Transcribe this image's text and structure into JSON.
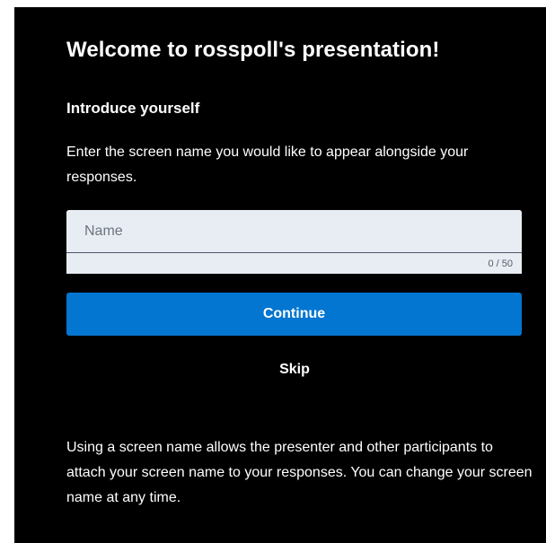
{
  "panel": {
    "title": "Welcome to rosspoll's presentation!",
    "subtitle": "Introduce yourself",
    "instructions": "Enter the screen name you would like to appear alongside your responses.",
    "name_input": {
      "value": "",
      "placeholder": "Name",
      "counter": "0 / 50"
    },
    "continue_label": "Continue",
    "skip_label": "Skip",
    "note": "Using a screen name allows the presenter and other participants to attach your screen name to your responses. You can change your screen name at any time."
  },
  "colors": {
    "panel_background": "#000000",
    "text": "#ffffff",
    "accent": "#0276d1",
    "input_background": "#e8edf3"
  }
}
